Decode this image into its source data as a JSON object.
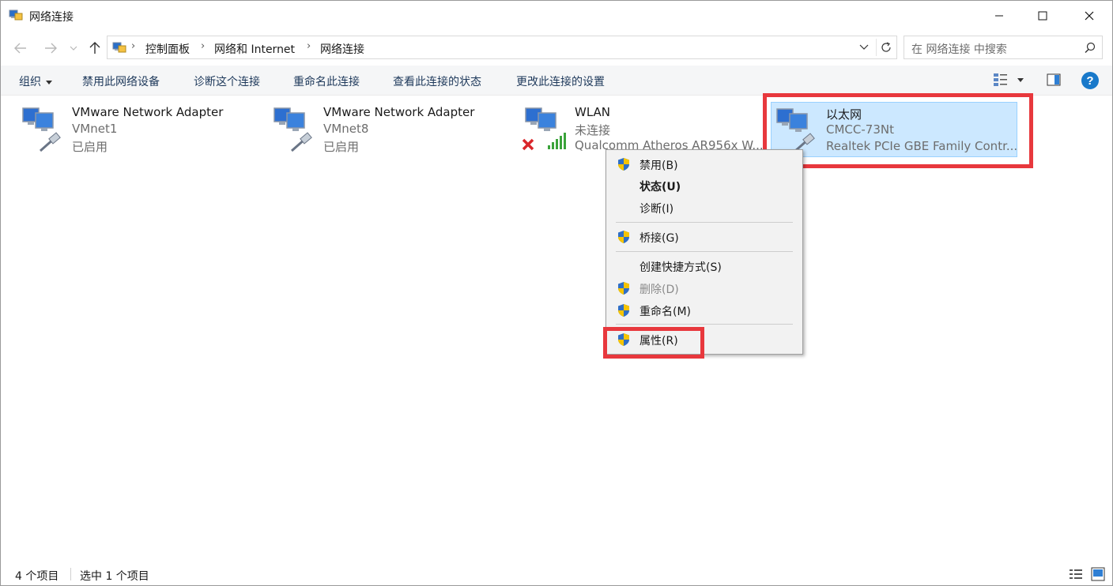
{
  "window": {
    "title": "网络连接",
    "minimize_label": "",
    "maximize_label": "",
    "close_label": ""
  },
  "nav": {
    "breadcrumb": [
      "控制面板",
      "网络和 Internet",
      "网络连接"
    ],
    "search_placeholder": "在 网络连接 中搜索"
  },
  "toolbar": {
    "organize": "组织",
    "commands": [
      "禁用此网络设备",
      "诊断这个连接",
      "重命名此连接",
      "查看此连接的状态",
      "更改此连接的设置"
    ]
  },
  "items": [
    {
      "name": "VMware Network Adapter",
      "line2": "VMnet1",
      "line3": "已启用",
      "type": "wired",
      "selected": false
    },
    {
      "name": "VMware Network Adapter",
      "line2": "VMnet8",
      "line3": "已启用",
      "type": "wired",
      "selected": false
    },
    {
      "name": "WLAN",
      "line2": "未连接",
      "line3": "Qualcomm Atheros AR956x W...",
      "type": "wireless",
      "selected": false
    },
    {
      "name": "以太网",
      "line2": "CMCC-73Nt",
      "line3": "Realtek PCIe GBE Family Contr...",
      "type": "wired",
      "selected": true
    }
  ],
  "context_menu": {
    "items": [
      {
        "label": "禁用(B)",
        "shield": true,
        "bold": false,
        "disabled": false
      },
      {
        "label": "状态(U)",
        "shield": false,
        "bold": true,
        "disabled": false
      },
      {
        "label": "诊断(I)",
        "shield": false,
        "bold": false,
        "disabled": false
      },
      {
        "label": "桥接(G)",
        "shield": true,
        "bold": false,
        "disabled": false
      },
      {
        "label": "创建快捷方式(S)",
        "shield": false,
        "bold": false,
        "disabled": false
      },
      {
        "label": "删除(D)",
        "shield": true,
        "bold": false,
        "disabled": true
      },
      {
        "label": "重命名(M)",
        "shield": true,
        "bold": false,
        "disabled": false
      },
      {
        "label": "属性(R)",
        "shield": true,
        "bold": false,
        "disabled": false
      }
    ]
  },
  "status": {
    "count": "4 个项目",
    "selected": "选中 1 个项目"
  },
  "colors": {
    "accent": "#1979ca",
    "selection": "#cce8ff",
    "highlight_box": "#e8383d"
  }
}
